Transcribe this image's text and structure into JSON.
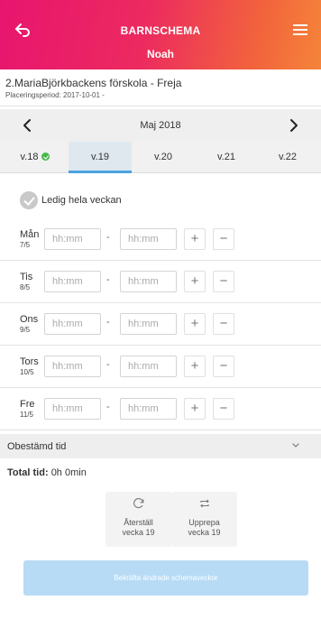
{
  "header": {
    "title": "BARNSCHEMA",
    "child_name": "Noah",
    "gradient_colors": [
      "#e8156f",
      "#f5843a"
    ]
  },
  "placement": {
    "school": "2.MariaBjörkbackens förskola - Freja",
    "period": "Placeringsperiod: 2017-10-01 -"
  },
  "month": {
    "label": "Maj 2018"
  },
  "weeks": [
    {
      "label": "v.18",
      "confirmed": true
    },
    {
      "label": "v.19",
      "selected": true
    },
    {
      "label": "v.20"
    },
    {
      "label": "v.21"
    },
    {
      "label": "v.22"
    }
  ],
  "free_week": {
    "label": "Ledig hela veckan"
  },
  "days": [
    {
      "name": "Mån",
      "date": "7/5"
    },
    {
      "name": "Tis",
      "date": "8/5"
    },
    {
      "name": "Ons",
      "date": "9/5"
    },
    {
      "name": "Tors",
      "date": "10/5"
    },
    {
      "name": "Fre",
      "date": "11/5"
    }
  ],
  "time_placeholder": "hh:mm",
  "separator": "-",
  "plus": "+",
  "minus": "−",
  "undetermined": {
    "label": "Obestämd tid"
  },
  "total": {
    "label": "Total tid:",
    "value": "0h 0min"
  },
  "actions": {
    "reset": {
      "line1": "Återställ",
      "line2": "vecka 19"
    },
    "repeat": {
      "line1": "Upprepa",
      "line2": "vecka 19"
    }
  },
  "confirm_button": "Bekräfta ändrade schemaveckor",
  "colors": {
    "accent_blue": "#4ba3df",
    "confirm_bg": "#b8dbf5",
    "check_green": "#45b84a"
  }
}
